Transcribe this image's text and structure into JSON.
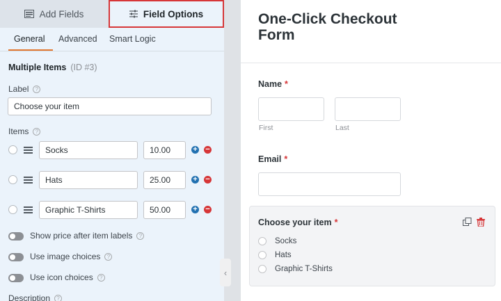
{
  "tabs": {
    "add_fields": "Add Fields",
    "field_options": "Field Options"
  },
  "subtabs": {
    "general": "General",
    "advanced": "Advanced",
    "smart_logic": "Smart Logic"
  },
  "field": {
    "type": "Multiple Items",
    "id": "(ID #3)",
    "label_heading": "Label",
    "label_value": "Choose your item",
    "items_heading": "Items",
    "items": [
      {
        "name": "Socks",
        "price": "10.00"
      },
      {
        "name": "Hats",
        "price": "25.00"
      },
      {
        "name": "Graphic T-Shirts",
        "price": "50.00"
      }
    ],
    "toggles": [
      {
        "label": "Show price after item labels"
      },
      {
        "label": "Use image choices"
      },
      {
        "label": "Use icon choices"
      }
    ],
    "description_heading": "Description"
  },
  "preview": {
    "title": "One-Click Checkout Form",
    "name_label": "Name",
    "first_sublabel": "First",
    "last_sublabel": "Last",
    "email_label": "Email",
    "choice_label": "Choose your item",
    "choices": [
      "Socks",
      "Hats",
      "Graphic T-Shirts"
    ],
    "required_mark": "*"
  },
  "colors": {
    "accent_orange": "#e27730",
    "highlight_red": "#d63638",
    "plus_blue": "#2271b1"
  },
  "icons": {
    "add_fields_tab": "list-icon",
    "field_options_tab": "sliders-icon",
    "help": "help-circle-icon",
    "drag": "drag-handle-icon",
    "add_item": "plus-circle-icon",
    "remove_item": "minus-circle-icon",
    "duplicate": "duplicate-icon",
    "delete": "trash-icon",
    "collapse": "chevron-left-icon"
  }
}
